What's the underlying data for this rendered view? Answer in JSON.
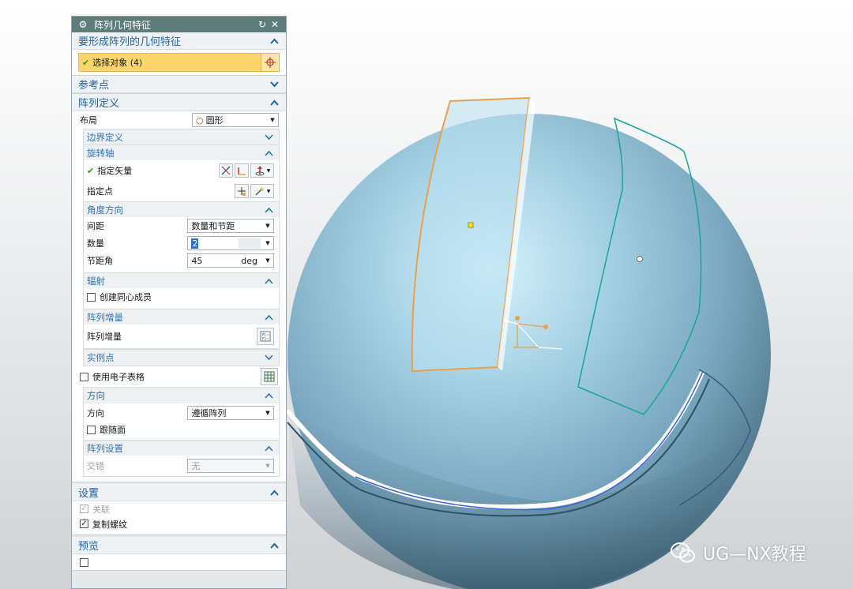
{
  "dialog": {
    "title": "阵列几何特征",
    "gear_icon": "gear-icon",
    "reset_icon": "reset-icon",
    "close_icon": "close-icon"
  },
  "features": {
    "header": "要形成阵列的几何特征",
    "select_label": "选择对象 (4)"
  },
  "reference": {
    "header": "参考点"
  },
  "definition": {
    "header": "阵列定义",
    "layout_label": "布局",
    "layout_value": "圆形",
    "boundary": {
      "header": "边界定义"
    },
    "axis": {
      "header": "旋转轴",
      "vector_label": "指定矢量",
      "point_label": "指定点"
    },
    "angle": {
      "header": "角度方向",
      "spacing_label": "间距",
      "spacing_value": "数量和节距",
      "count_label": "数量",
      "count_value": "2",
      "pitch_label": "节距角",
      "pitch_value": "45",
      "pitch_unit": "deg"
    },
    "radial": {
      "header": "辐射",
      "concentric_label": "创建同心成员"
    },
    "increment": {
      "header": "阵列增量",
      "label": "阵列增量"
    },
    "instance": {
      "header": "实例点",
      "spreadsheet_label": "使用电子表格"
    },
    "direction": {
      "header": "方向",
      "label": "方向",
      "value": "遵循阵列",
      "follow_face_label": "跟随面"
    },
    "pattern_settings": {
      "header": "阵列设置",
      "stagger_label": "交错",
      "stagger_value": "无"
    }
  },
  "settings": {
    "header": "设置",
    "associative_label": "关联",
    "copy_threads_label": "复制螺纹"
  },
  "preview": {
    "header": "预览"
  },
  "watermark": {
    "text": "UG—NX教程"
  },
  "colors": {
    "title_bar": "#5d7d7a",
    "group_header_text": "#1c63a8",
    "selection_highlight": "#fcd66b",
    "selected_curve": "#e8a04a",
    "pattern_curve": "#1aa59a"
  }
}
